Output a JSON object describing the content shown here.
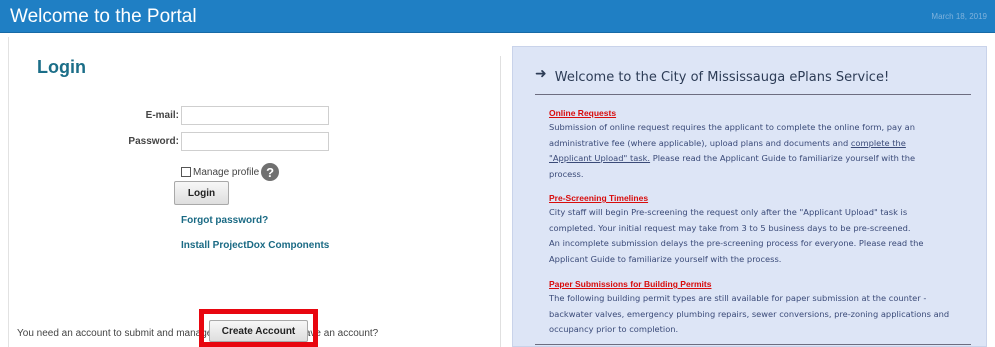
{
  "header": {
    "title": "Welcome to the Portal",
    "date": "March 18, 2019"
  },
  "login": {
    "heading": "Login",
    "email_label": "E-mail:",
    "email_value": "",
    "password_label": "Password:",
    "password_value": "",
    "manage_profile_label": "Manage profile",
    "manage_profile_checked": false,
    "help_icon_glyph": "?",
    "login_button": "Login",
    "forgot_password": "Forgot password?",
    "install_components": "Install ProjectDox Components",
    "account_prompt": "You need an account to submit and manage applications. Don't have an account?",
    "create_account_button": "Create Account"
  },
  "info": {
    "arrow_icon": "arrow-right-icon",
    "welcome": "Welcome to the City of Mississauga ePlans Service!",
    "sections": [
      {
        "title": "Online Requests",
        "lines": [
          "Submission of online request requires the applicant to complete the online form, pay an",
          "administrative fee (where applicable), upload plans and documents and ",
          "complete the",
          "\"Applicant Upload\" task.",
          " Please read the Applicant Guide to familiarize yourself with the",
          "process."
        ]
      },
      {
        "title": "Pre-Screening Timelines",
        "lines": [
          "City staff will begin Pre-screening the request only after the \"Applicant Upload\" task is",
          "completed. Your initial request may take from 3 to 5 business days to be pre-screened.",
          "An incomplete submission delays the pre-screening process for everyone. Please read the",
          "Applicant Guide to familiarize yourself with the process."
        ]
      },
      {
        "title": "Paper Submissions for Building Permits",
        "lines": [
          "The following building permit types are still available for paper submission at the counter -",
          "backwater valves, emergency plumbing repairs, sewer conversions, pre-zoning applications and",
          "occupancy prior to completion."
        ]
      }
    ]
  },
  "colors": {
    "header_bg": "#1f7fc4",
    "accent_teal": "#1b6e88",
    "info_panel_bg": "#dde5f6",
    "section_title_red": "#d80c0c",
    "highlight_red": "#e8060f"
  }
}
